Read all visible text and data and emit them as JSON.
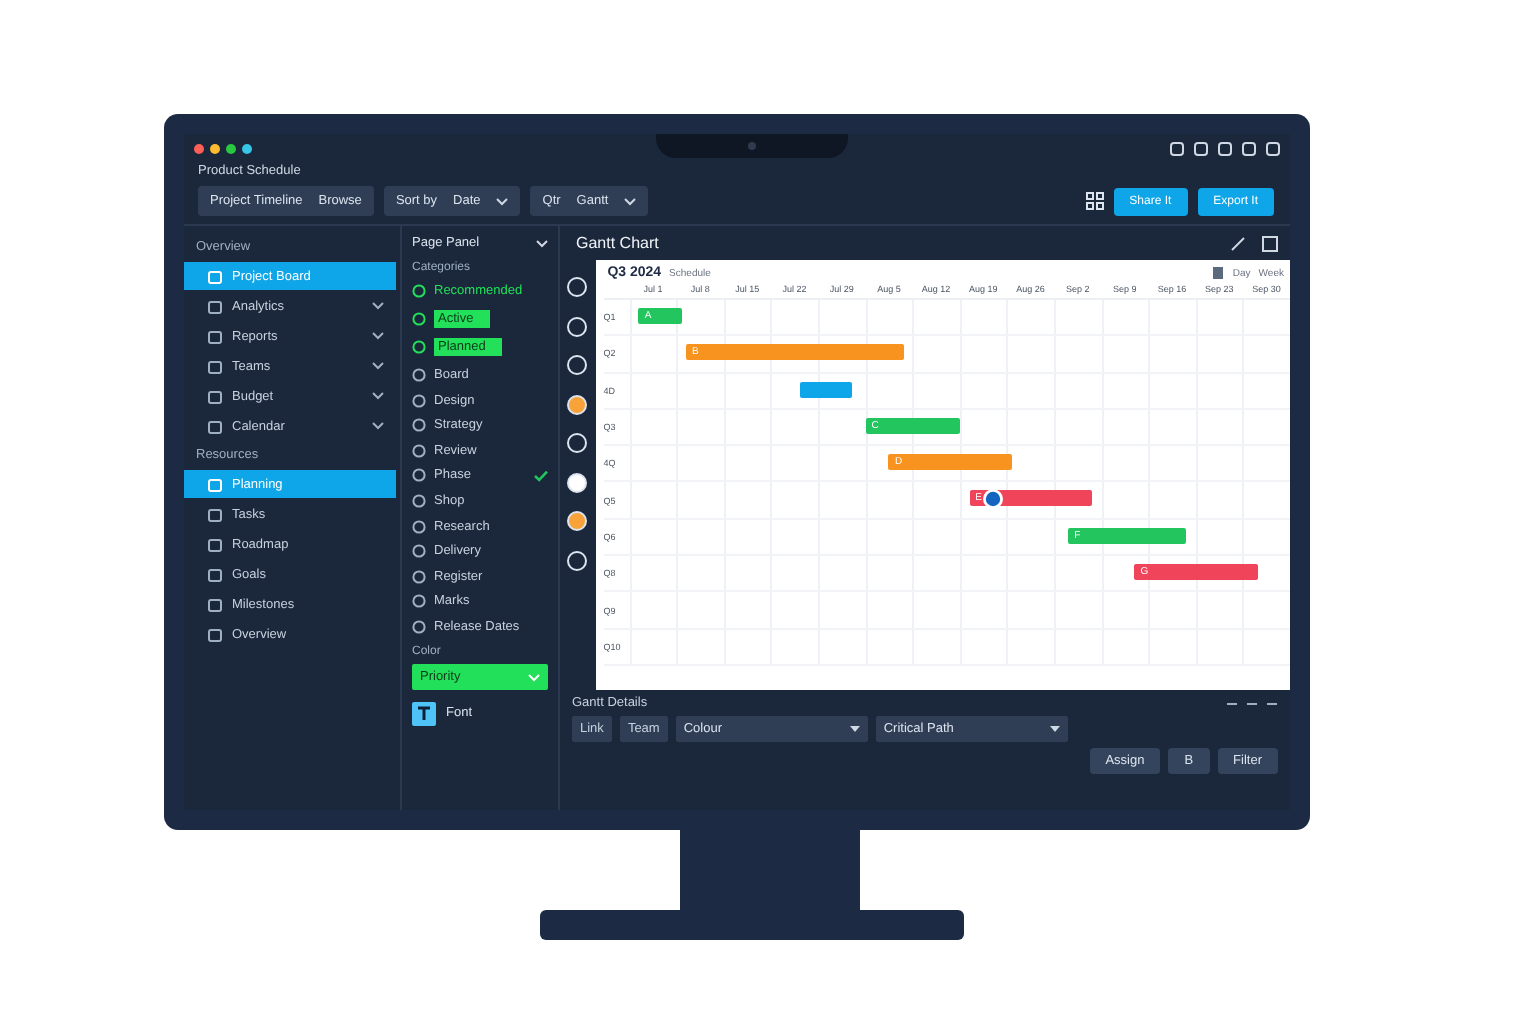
{
  "app_title": "Product Schedule",
  "toolbar": {
    "dropdowns": [
      {
        "label": "Project Timeline",
        "value": "Browse",
        "chevron": false
      },
      {
        "label": "Sort by",
        "value": "Date",
        "chevron": true
      },
      {
        "label": "Qtr",
        "value": "Gantt",
        "chevron": true
      }
    ],
    "buttons": [
      "Share It",
      "Export It"
    ]
  },
  "sidebar": [
    {
      "title": "Overview",
      "items": [
        {
          "label": "Project Board",
          "selected": true,
          "expandable": false
        },
        {
          "label": "Analytics",
          "selected": false,
          "expandable": true
        },
        {
          "label": "Reports",
          "selected": false,
          "expandable": true
        },
        {
          "label": "Teams",
          "selected": false,
          "expandable": true
        },
        {
          "label": "Budget",
          "selected": false,
          "expandable": true
        },
        {
          "label": "Calendar",
          "selected": false,
          "expandable": true
        }
      ]
    },
    {
      "title": "Resources",
      "items": [
        {
          "label": "Planning",
          "selected": true,
          "expandable": false
        },
        {
          "label": "Tasks",
          "selected": false,
          "expandable": false
        },
        {
          "label": "Roadmap",
          "selected": false,
          "expandable": false
        },
        {
          "label": "Goals",
          "selected": false,
          "expandable": false
        },
        {
          "label": "Milestones",
          "selected": false,
          "expandable": false
        },
        {
          "label": "Overview",
          "selected": false,
          "expandable": false
        }
      ]
    }
  ],
  "panel": {
    "title": "Page Panel",
    "subtitle": "Categories",
    "items": [
      {
        "label": "Recommended",
        "kind": "accent",
        "checked": false
      },
      {
        "label": "Active",
        "kind": "highlight",
        "checked": false
      },
      {
        "label": "Planned",
        "kind": "highlight",
        "checked": false
      },
      {
        "label": "Board",
        "kind": "plain",
        "checked": false
      },
      {
        "label": "Design",
        "kind": "plain",
        "checked": false
      },
      {
        "label": "Strategy",
        "kind": "plain",
        "checked": false
      },
      {
        "label": "Review",
        "kind": "plain",
        "checked": false
      },
      {
        "label": "Phase",
        "kind": "plain",
        "checked": true
      },
      {
        "label": "Shop",
        "kind": "plain",
        "checked": false
      },
      {
        "label": "Research",
        "kind": "plain",
        "checked": false
      },
      {
        "label": "Delivery",
        "kind": "plain",
        "checked": false
      },
      {
        "label": "Register",
        "kind": "plain",
        "checked": false
      },
      {
        "label": "Marks",
        "kind": "plain",
        "checked": false
      },
      {
        "label": "Release Dates",
        "kind": "plain",
        "checked": false
      }
    ],
    "color_label": "Color",
    "color_select": "Priority",
    "font_label": "Font"
  },
  "main": {
    "title": "Gantt Chart",
    "gantt": {
      "title": "Q3 2024",
      "subtitle": "Schedule",
      "views": [
        "Day",
        "Week"
      ],
      "columns": [
        "Jul 1",
        "Jul 8",
        "Jul 15",
        "Jul 22",
        "Jul 29",
        "Aug 5",
        "Aug 12",
        "Aug 19",
        "Aug 26",
        "Sep 2",
        "Sep 9",
        "Sep 16",
        "Sep 23",
        "Sep 30"
      ],
      "rows": [
        {
          "label": "Q1",
          "avatar": false,
          "bar": {
            "label": "A",
            "color": "#22c55e"
          }
        },
        {
          "label": "Q2",
          "avatar": false,
          "bar": {
            "label": "B",
            "color": "#f7931e"
          }
        },
        {
          "label": "4D",
          "avatar": false,
          "bar": {
            "color": "#0ea5e9"
          }
        },
        {
          "label": "Q3",
          "avatar": false,
          "bar": {
            "label": "C",
            "color": "#22c55e"
          }
        },
        {
          "label": "4Q",
          "avatar": false,
          "bar": {
            "label": "D",
            "color": "#f7931e"
          }
        },
        {
          "label": "Q5",
          "avatar": true,
          "bar": {
            "label": "E",
            "color": "#ef4459"
          }
        },
        {
          "label": "Q6",
          "avatar": false,
          "bar": {
            "label": "F",
            "color": "#22c55e"
          }
        },
        {
          "label": "Q8",
          "avatar": false,
          "bar": {
            "label": "G",
            "color": "#ef4459"
          }
        },
        {
          "label": "Q9",
          "avatar": false
        },
        {
          "label": "Q10",
          "avatar": false
        }
      ]
    }
  },
  "details": {
    "title": "Gantt Details",
    "tags": [
      "Link",
      "Team"
    ],
    "selects": [
      "Colour",
      "Critical Path"
    ],
    "buttons": [
      "Assign",
      "B",
      "Filter"
    ]
  }
}
